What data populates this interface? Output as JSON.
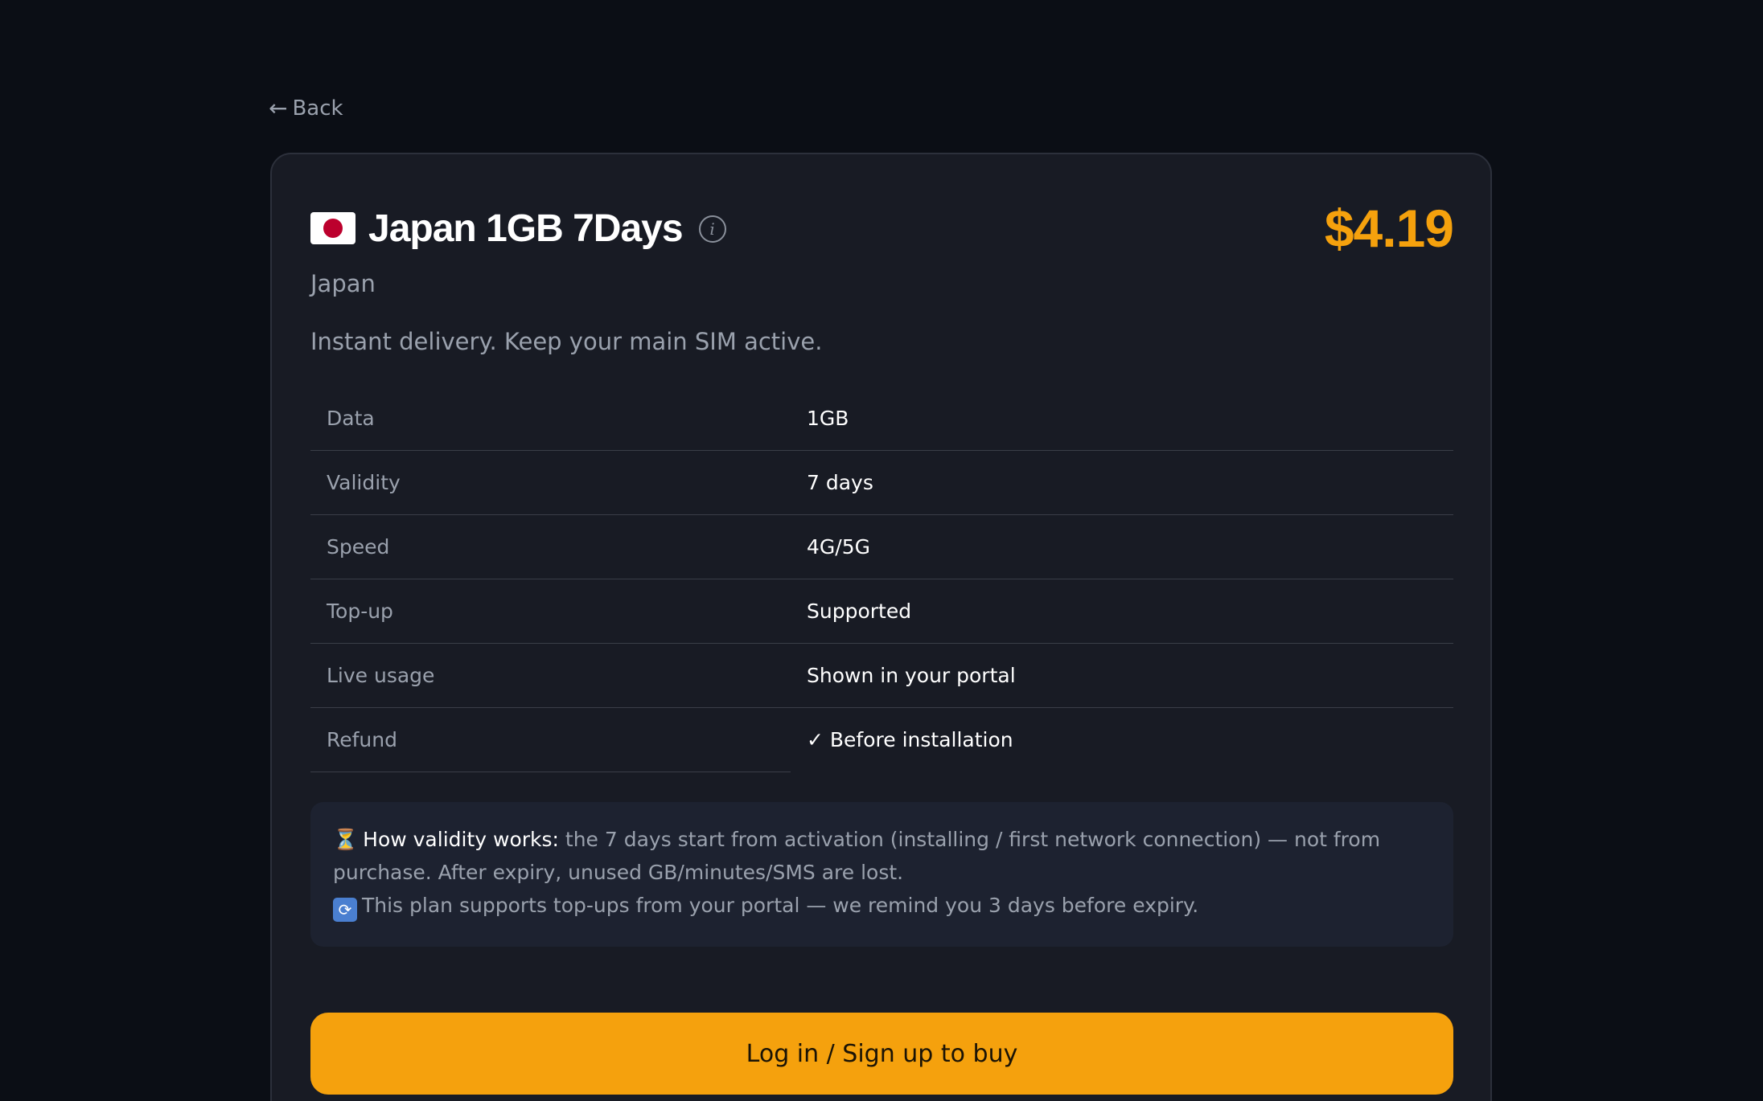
{
  "nav": {
    "back_arrow": "←",
    "back_label": "Back"
  },
  "plan": {
    "flag_icon": "japan-flag",
    "title": "Japan 1GB 7Days",
    "info_icon": "i",
    "price": "$4.19",
    "country": "Japan",
    "tagline": "Instant delivery. Keep your main SIM active."
  },
  "specs": [
    {
      "label": "Data",
      "value": "1GB"
    },
    {
      "label": "Validity",
      "value": "7 days"
    },
    {
      "label": "Speed",
      "value": "4G/5G"
    },
    {
      "label": "Top-up",
      "value": "Supported"
    },
    {
      "label": "Live usage",
      "value": "Shown in your portal"
    },
    {
      "label": "Refund",
      "value": "✓ Before installation"
    }
  ],
  "note": {
    "hourglass_icon": "⏳",
    "validity_heading": "How validity works:",
    "validity_text": "the 7 days start from activation (installing / first network connection) — not from purchase. After expiry, unused GB/minutes/SMS are lost.",
    "refresh_icon": "🔄",
    "topup_text": "This plan supports top-ups from your portal — we remind you 3 days before expiry."
  },
  "cta": {
    "label": "Log in / Sign up to buy"
  },
  "colors": {
    "background": "#0b0e15",
    "card": "#181b24",
    "accent": "#f5a10d",
    "muted_text": "#9aa1ad"
  }
}
